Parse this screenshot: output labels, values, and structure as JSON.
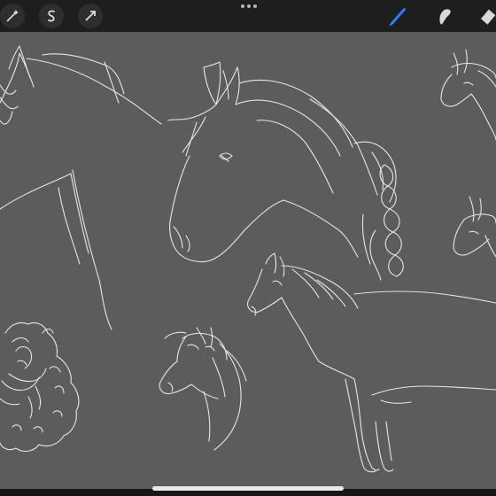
{
  "app": {
    "window_title": ""
  },
  "toolbar": {
    "left_tools": [
      {
        "name": "adjustments-wand",
        "icon": "magic-wand-icon"
      },
      {
        "name": "selection",
        "icon": "selection-s-icon"
      },
      {
        "name": "transform",
        "icon": "arrow-cursor-icon"
      }
    ],
    "more_menu_icon": "ellipsis-icon",
    "right_tools": [
      {
        "name": "brush",
        "icon": "brush-icon",
        "active": true
      },
      {
        "name": "smudge",
        "icon": "smudge-finger-icon",
        "active": false
      },
      {
        "name": "eraser",
        "icon": "eraser-icon",
        "active": false
      }
    ]
  },
  "colors": {
    "toolbar_bg": "#1e1e1e",
    "canvas_bg": "#5c5c5c",
    "stroke": "#e8e8e8",
    "active_tool_accent": "#2f7cf6"
  },
  "canvas": {
    "content": "sketch",
    "subjects": [
      "horse-head-1",
      "horse-head-2",
      "horse-head-3",
      "horse-head-4",
      "horse-full-body",
      "pony-curly-mane",
      "pony-small-head"
    ]
  }
}
